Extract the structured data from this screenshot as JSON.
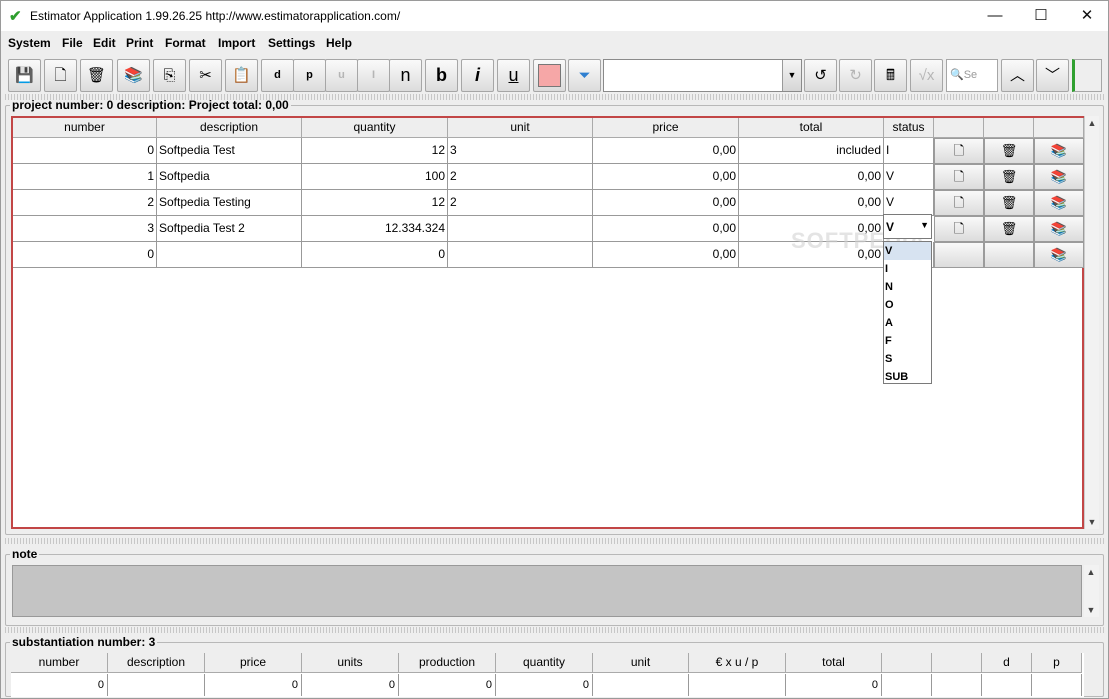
{
  "window": {
    "title": "Estimator Application 1.99.26.25 http://www.estimatorapplication.com/",
    "controls": {
      "minimize": "—",
      "maximize": "☐",
      "close": "✕"
    }
  },
  "menu": [
    "System",
    "File",
    "Edit",
    "Print",
    "Format",
    "Import",
    "Settings",
    "Help"
  ],
  "toolbar": {
    "buttons": [
      {
        "name": "save-icon",
        "glyph": "💾"
      },
      {
        "name": "new-document-icon",
        "glyph": "🗋"
      },
      {
        "name": "trash-icon",
        "glyph": "🗑"
      },
      {
        "name": "books-icon",
        "glyph": "📚"
      },
      {
        "name": "copy-icon",
        "glyph": "⎘"
      },
      {
        "name": "cut-icon",
        "glyph": "✂"
      },
      {
        "name": "paste-icon",
        "glyph": "📋"
      }
    ],
    "format_buttons": [
      "d",
      "p",
      "u",
      "I",
      "n",
      "b",
      "i",
      "u"
    ],
    "color_swatch": "#f6a7a7",
    "filter_icon": "filter-icon",
    "combo_value": "",
    "search_placeholder": "Se"
  },
  "project": {
    "legend": "project number: 0 description:  Project total: 0,00",
    "columns": [
      "number",
      "description",
      "quantity",
      "unit",
      "price",
      "total",
      "status"
    ],
    "rows": [
      {
        "number": "0",
        "description": "Softpedia Test",
        "quantity": "12",
        "unit": "3",
        "price": "0,00",
        "total": "included",
        "status": "I"
      },
      {
        "number": "1",
        "description": "Softpedia",
        "quantity": "100",
        "unit": "2",
        "price": "0,00",
        "total": "0,00",
        "status": "V"
      },
      {
        "number": "2",
        "description": "Softpedia Testing",
        "quantity": "12",
        "unit": "2",
        "price": "0,00",
        "total": "0,00",
        "status": "V"
      },
      {
        "number": "3",
        "description": "Softpedia Test 2",
        "quantity": "12.334.324",
        "unit": "",
        "price": "0,00",
        "total": "0,00",
        "status": "V"
      },
      {
        "number": "0",
        "description": "",
        "quantity": "0",
        "unit": "",
        "price": "0,00",
        "total": "0,00",
        "status": ""
      }
    ],
    "status_options": [
      "V",
      "I",
      "N",
      "O",
      "A",
      "F",
      "S",
      "SUB"
    ],
    "status_selected": "V"
  },
  "note": {
    "legend": "note",
    "text": ""
  },
  "substantiation": {
    "legend": "substantiation number: 3",
    "columns": [
      "number",
      "description",
      "price",
      "units",
      "production",
      "quantity",
      "unit",
      "€ x u / p",
      "total",
      "",
      "",
      "d",
      "p"
    ],
    "row": [
      "0",
      "",
      "0",
      "0",
      "0",
      "0",
      "",
      "",
      "0",
      "",
      "",
      "",
      ""
    ]
  },
  "watermark": "SOFTPEDIA"
}
